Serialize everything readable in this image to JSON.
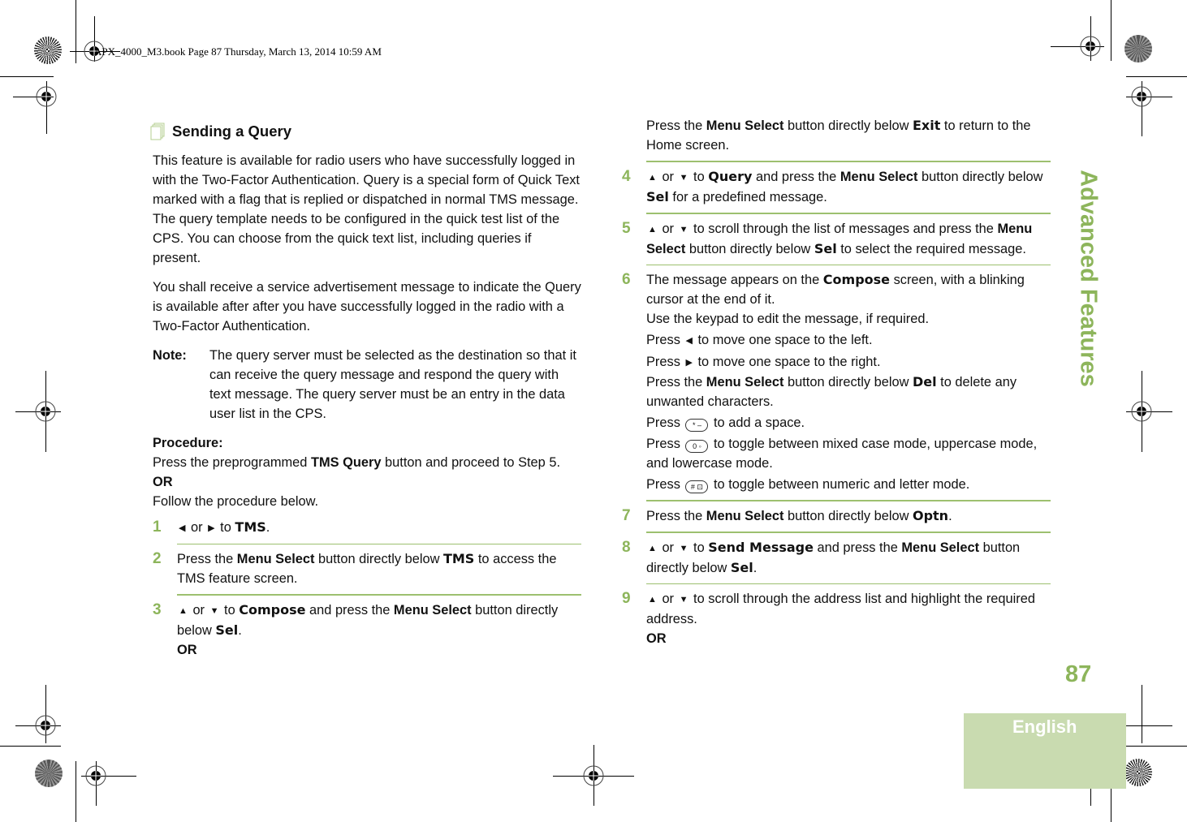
{
  "print_slug": "APX_4000_M3.book  Page 87  Thursday, March 13, 2014  10:59 AM",
  "side_title": "Advanced Features",
  "page_number": "87",
  "language_tab": "English",
  "accent_color": "#8db55b",
  "left_column": {
    "heading": "Sending a Query",
    "heading_icon": "document-stack-icon",
    "para1": "This feature is available for radio users who have successfully logged in with the Two-Factor Authentication. Query is a special form of Quick Text marked with a flag that is replied or dispatched in normal TMS message. The query template needs to be configured in the quick test list of the CPS. You can choose from the quick text list, including queries if present.",
    "para2": "You shall receive a service advertisement message to indicate the Query is available after after you have successfully logged in the radio with a Two-Factor Authentication.",
    "note_label": "Note:",
    "note_text": "The query server must be selected as the destination so that it can receive the query message and respond the query with text message. The query server must be an entry in the data user list in the CPS.",
    "procedure_label": "Procedure:",
    "procedure_line1_pre": "Press the preprogrammed ",
    "procedure_line1_bold": "TMS Query",
    "procedure_line1_post": " button and proceed to Step 5.",
    "or_label": "OR",
    "procedure_line2": "Follow the procedure below.",
    "steps": [
      {
        "num": "1",
        "t1": " or ",
        "t2": " to ",
        "lcd": "TMS",
        "t3": "."
      },
      {
        "num": "2",
        "t1": "Press the ",
        "b1": "Menu Select",
        "t2": " button directly below ",
        "lcd": "TMS",
        "t3": " to access the TMS feature screen."
      },
      {
        "num": "3",
        "t1": " or ",
        "t2": " to ",
        "lcd": "Compose",
        "t3": " and press the ",
        "b1": "Menu Select",
        "t4": " button directly below ",
        "lcd2": "Sel",
        "t5": ".",
        "or": "OR"
      }
    ]
  },
  "right_column": {
    "cont_t1": "Press the ",
    "cont_b1": "Menu Select",
    "cont_t2": " button directly below ",
    "cont_lcd": "Exit",
    "cont_t3": " to return to the Home screen.",
    "steps": [
      {
        "num": "4",
        "t1": " or ",
        "t2": " to ",
        "lcd": "Query",
        "t3": " and press the ",
        "b1": "Menu Select",
        "t4": " button directly below ",
        "lcd2": "Sel",
        "t5": " for a predefined message."
      },
      {
        "num": "5",
        "t1": " or ",
        "t2": " to scroll through the list of messages and press the ",
        "b1": "Menu Select",
        "t3": " button directly below ",
        "lcd": "Sel",
        "t4": " to select the required message."
      },
      {
        "num": "6",
        "t1": "The message appears on the ",
        "lcd": "Compose",
        "t2": " screen, with a blinking cursor at the end of it.",
        "s1": "Use the keypad to edit the message, if required.",
        "s2_pre": "Press ",
        "s2_post": " to move one space to the left.",
        "s3_pre": "Press ",
        "s3_post": " to move one space to the right.",
        "s4_pre": "Press the ",
        "s4_b": "Menu Select",
        "s4_mid": " button directly below ",
        "s4_lcd": "Del",
        "s4_post": " to delete any unwanted characters.",
        "s5_pre": "Press ",
        "s5_key": "* –",
        "s5_post": " to add a space.",
        "s6_pre": "Press ",
        "s6_key": "0 ◦",
        "s6_post": " to toggle between mixed case mode, uppercase mode, and lowercase mode.",
        "s7_pre": "Press ",
        "s7_key": "# ⊡",
        "s7_post": " to toggle between numeric and letter mode."
      },
      {
        "num": "7",
        "t1": "Press the ",
        "b1": "Menu Select",
        "t2": " button directly below ",
        "lcd": "Optn",
        "t3": "."
      },
      {
        "num": "8",
        "t1": " or ",
        "t2": " to ",
        "lcd": "Send Message",
        "t3": " and press the ",
        "b1": "Menu Select",
        "t4": " button directly below ",
        "lcd2": "Sel",
        "t5": "."
      },
      {
        "num": "9",
        "t1": " or ",
        "t2": " to scroll through the address list and highlight the required address.",
        "or": "OR"
      }
    ]
  },
  "glyphs": {
    "left": "◀",
    "right": "▶",
    "up": "▲",
    "down": "▼"
  }
}
